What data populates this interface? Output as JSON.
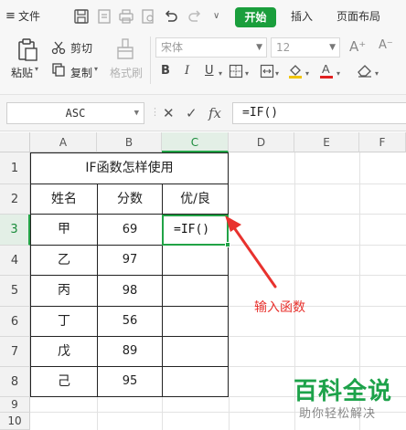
{
  "menu": {
    "file_label": "文件",
    "tabs": [
      {
        "label": "开始",
        "active": true
      },
      {
        "label": "插入",
        "active": false
      },
      {
        "label": "页面布局",
        "active": false
      }
    ]
  },
  "ribbon": {
    "paste_label": "粘贴",
    "cut_label": "剪切",
    "copy_label": "复制",
    "format_painter_label": "格式刷",
    "font_name": "宋体",
    "font_size": "12"
  },
  "formula_bar": {
    "name_box": "ASC",
    "formula": "=IF()"
  },
  "sheet": {
    "columns": [
      "A",
      "B",
      "C",
      "D",
      "E",
      "F"
    ],
    "rows": [
      "1",
      "2",
      "3",
      "4",
      "5",
      "6",
      "7",
      "8",
      "9",
      "10"
    ],
    "title": "IF函数怎样使用",
    "headers": [
      "姓名",
      "分数",
      "优/良"
    ],
    "records": [
      {
        "name": "甲",
        "score": "69"
      },
      {
        "name": "乙",
        "score": "97"
      },
      {
        "name": "丙",
        "score": "98"
      },
      {
        "name": "丁",
        "score": "56"
      },
      {
        "name": "戊",
        "score": "89"
      },
      {
        "name": "己",
        "score": "95"
      }
    ],
    "active_cell_text": "=IF()"
  },
  "annotation": "输入函数",
  "watermark": {
    "title": "百科全说",
    "subtitle": "助你轻松解决"
  },
  "colors": {
    "accent_green": "#1a9e3c",
    "annotation_red": "#e8322e"
  }
}
